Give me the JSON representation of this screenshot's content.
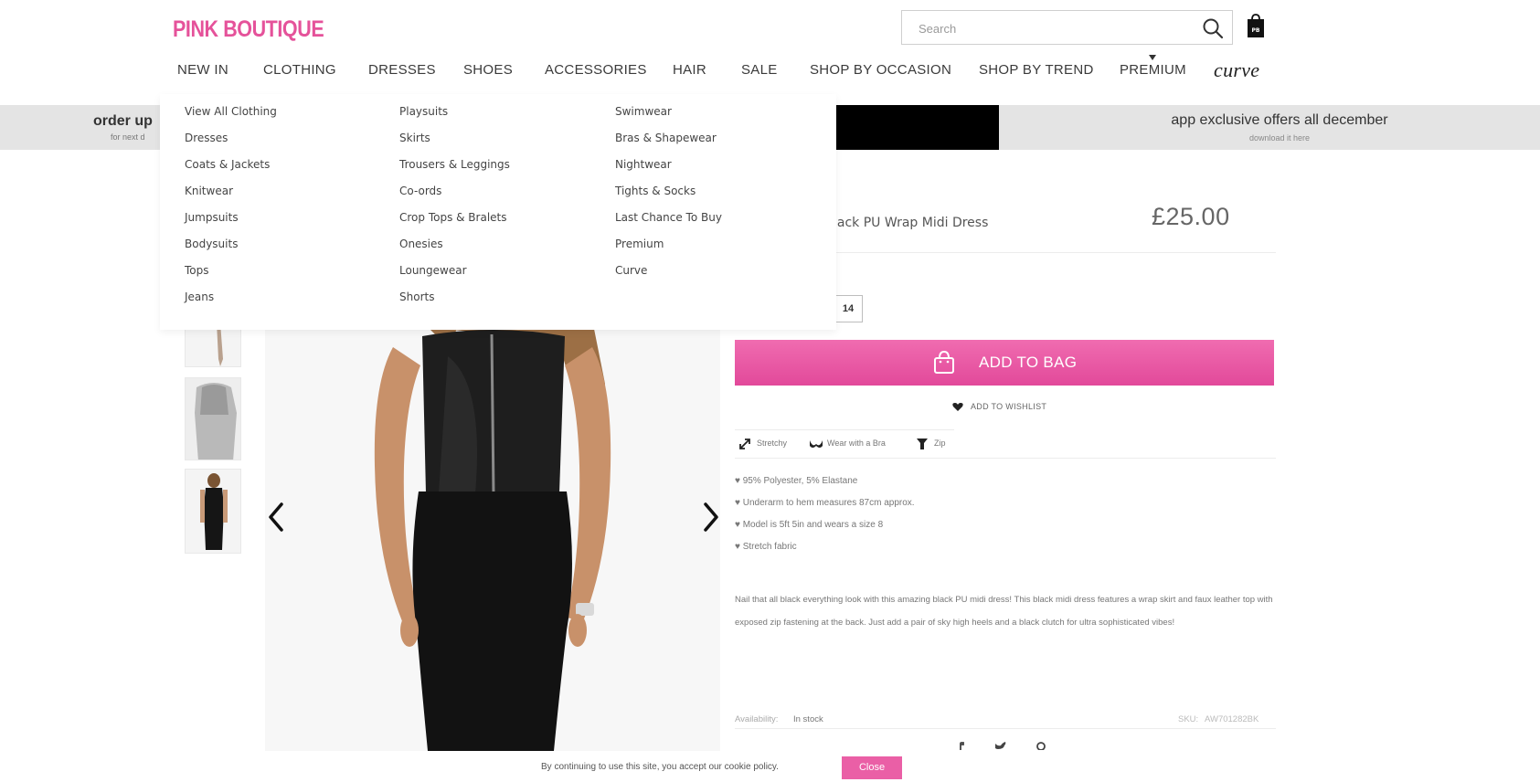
{
  "brand": {
    "logo": "PINK BOUTIQUE",
    "accent_color": "#e5529a"
  },
  "search": {
    "placeholder": "Search"
  },
  "nav": {
    "items": [
      "NEW IN",
      "CLOTHING",
      "DRESSES",
      "SHOES",
      "ACCESSORIES",
      "HAIR",
      "SALE",
      "SHOP BY OCCASION",
      "SHOP BY TREND",
      "PREMIUM"
    ],
    "curve": "curve"
  },
  "promo": {
    "left_title": "order up",
    "left_sub": "for next d",
    "right_title": "app exclusive offers all december",
    "right_sub": "download it here"
  },
  "dropdown": {
    "col1": [
      "View All Clothing",
      "Dresses",
      "Coats & Jackets",
      "Knitwear",
      "Jumpsuits",
      "Bodysuits",
      "Tops",
      "Jeans"
    ],
    "col2": [
      "Playsuits",
      "Skirts",
      "Trousers & Leggings",
      "Co-ords",
      "Crop Tops & Bralets",
      "Onesies",
      "Loungewear",
      "Shorts"
    ],
    "col3": [
      "Swimwear",
      "Bras & Shapewear",
      "Nightwear",
      "Tights & Socks",
      "Last Chance To Buy",
      "Premium",
      "Curve"
    ]
  },
  "product": {
    "name": "lack PU Wrap Midi Dress",
    "price": "£25.00",
    "size": "14",
    "add_to_bag": "ADD TO BAG",
    "wishlist": "ADD TO WISHLIST",
    "features": [
      "Stretchy",
      "Wear with a Bra",
      "Zip"
    ],
    "bullets": [
      "95% Polyester, 5% Elastane",
      "Underarm to hem measures 87cm approx.",
      "Model is 5ft 5in and wears a size 8",
      "Stretch fabric"
    ],
    "description": "Nail that all black everything look with this amazing black PU midi dress! This black midi dress features a wrap skirt and faux leather top with exposed zip fastening at the back. Just add a pair of sky high heels and a black clutch for ultra sophisticated vibes!",
    "availability_label": "Availability:",
    "availability_value": "In stock",
    "sku_label": "SKU:",
    "sku_value": "AW701282BK"
  },
  "cookie": {
    "text": "By continuing to use this site, you accept our cookie policy.",
    "close": "Close"
  }
}
